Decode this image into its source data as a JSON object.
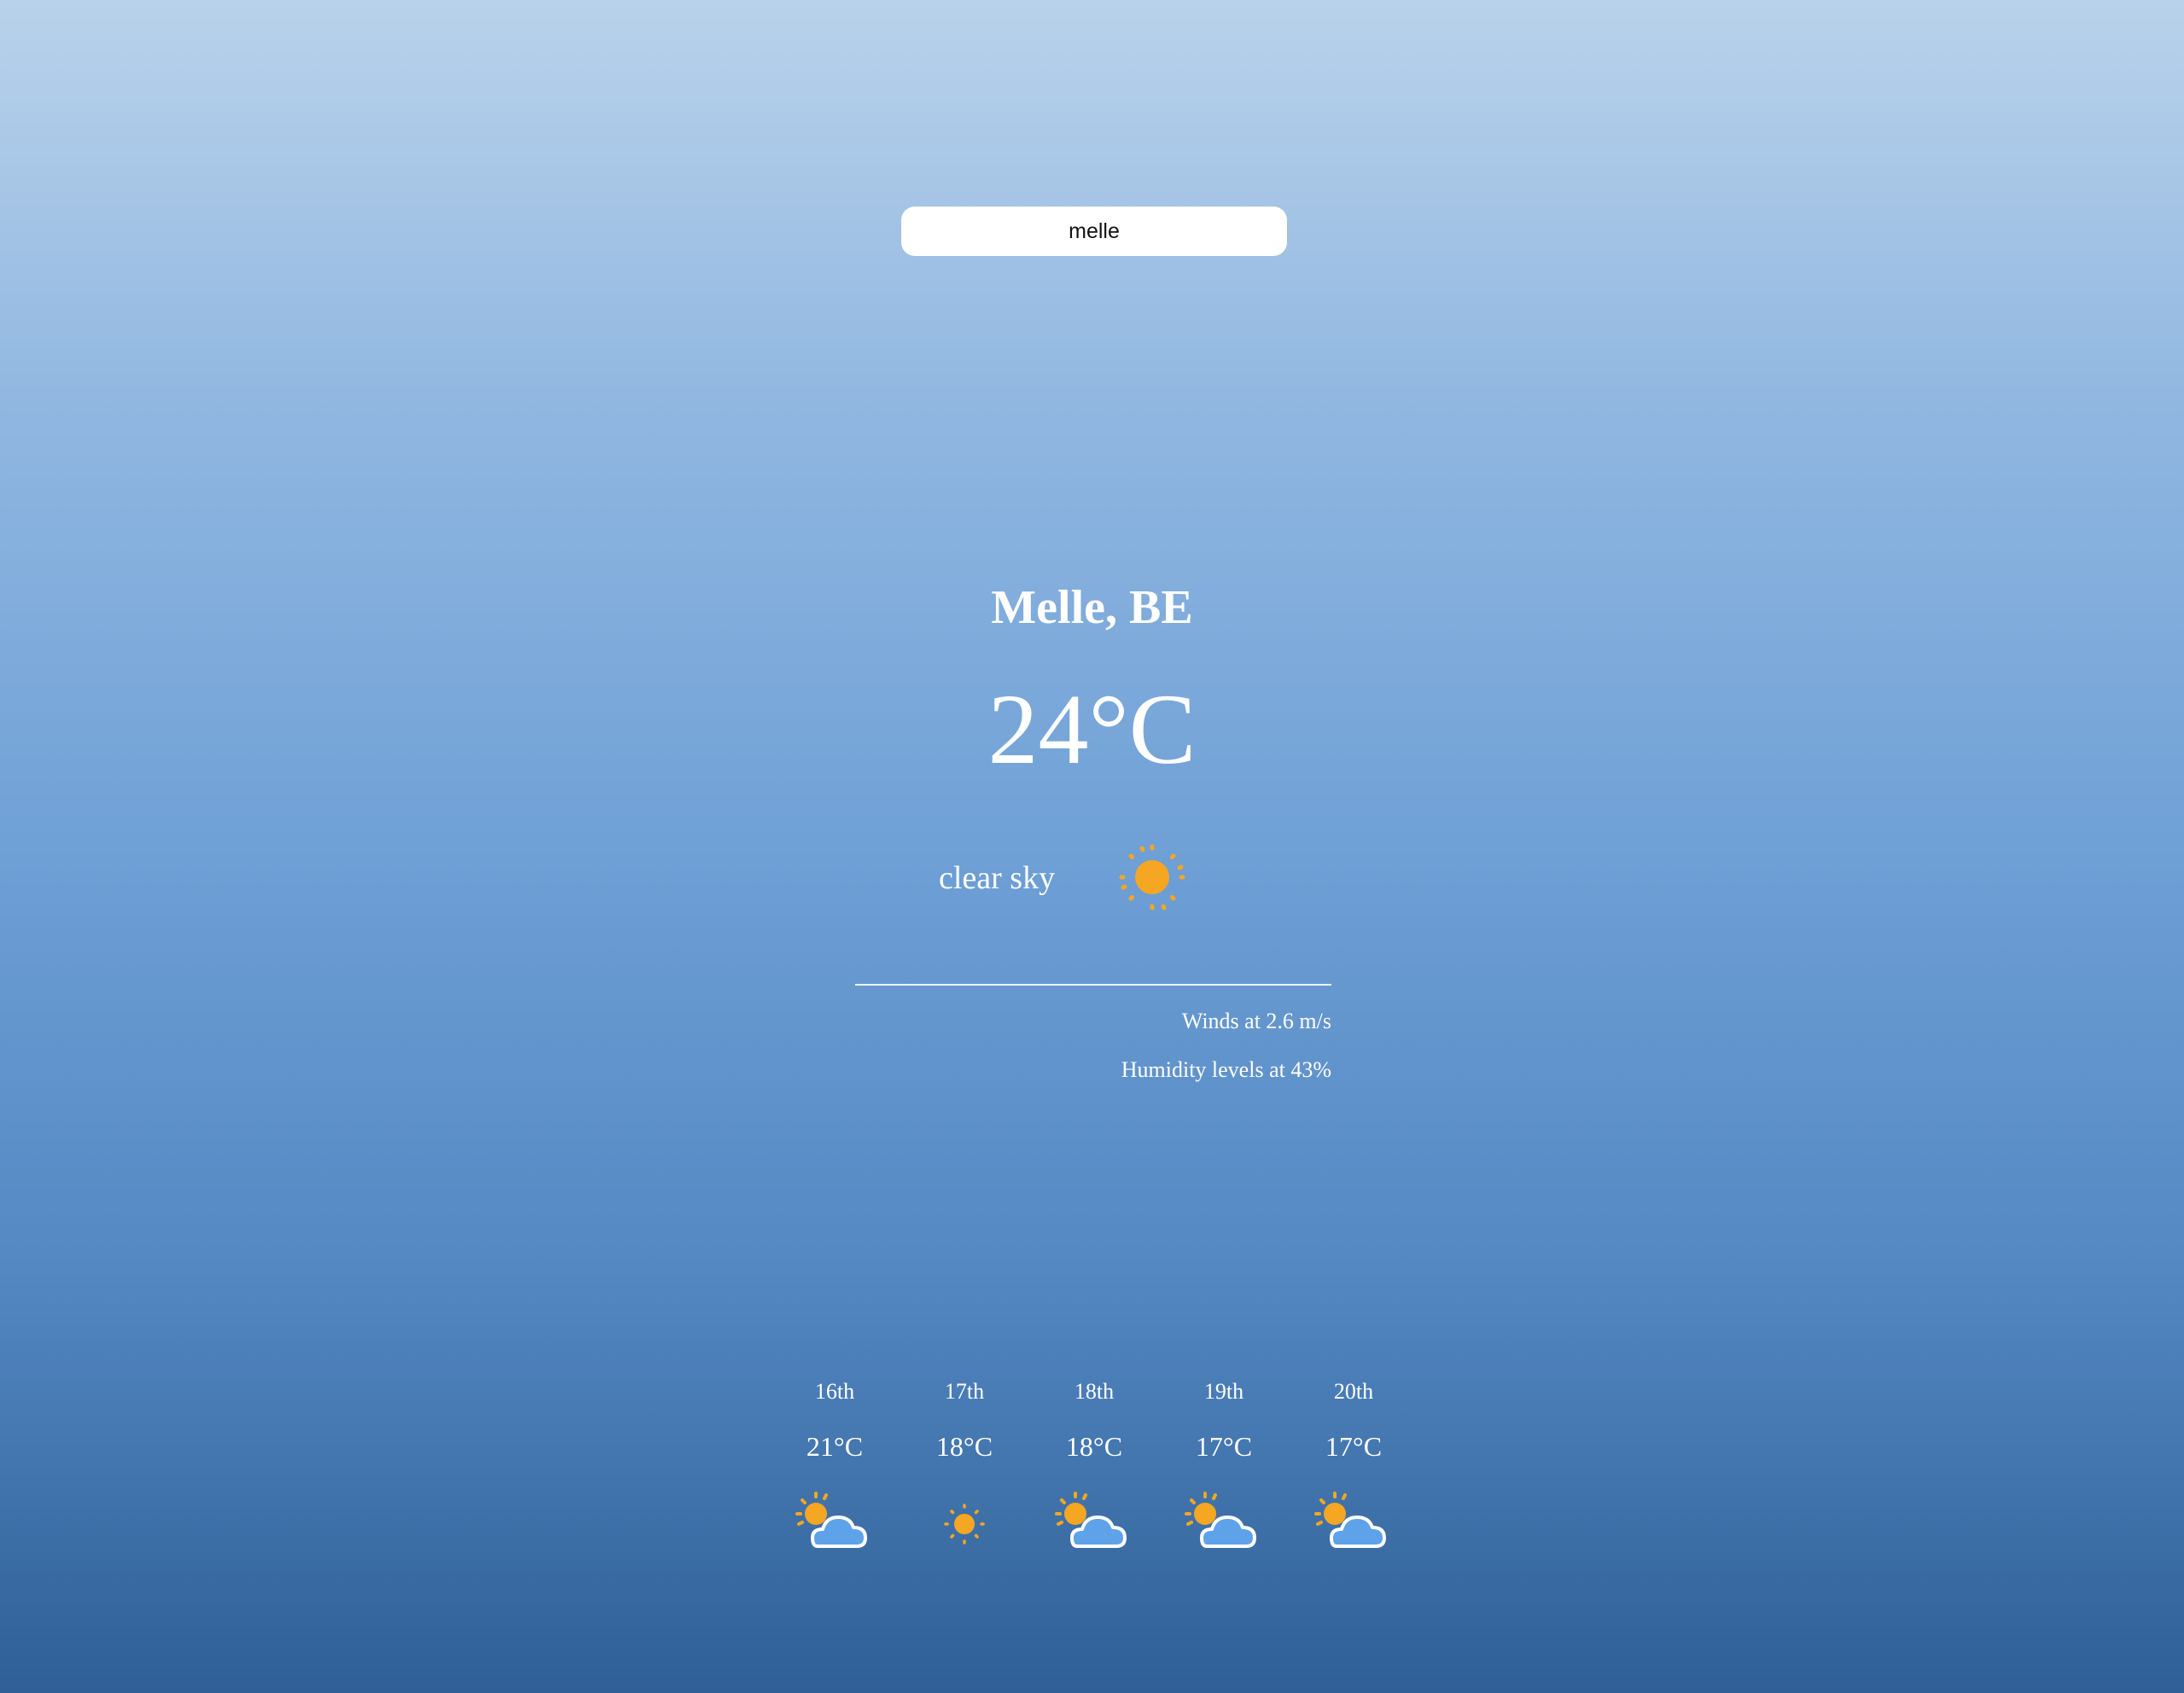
{
  "search": {
    "value": "melle",
    "placeholder": ""
  },
  "current": {
    "location": "Melle, BE",
    "temperature": "24°C",
    "condition": "clear sky",
    "condition_icon": "sun-icon",
    "wind": "Winds at 2.6 m/s",
    "humidity": "Humidity levels at 43%"
  },
  "forecast": [
    {
      "date": "16th",
      "temp": "21°C",
      "icon": "partly-cloudy-icon"
    },
    {
      "date": "17th",
      "temp": "18°C",
      "icon": "sun-icon"
    },
    {
      "date": "18th",
      "temp": "18°C",
      "icon": "partly-cloudy-icon"
    },
    {
      "date": "19th",
      "temp": "17°C",
      "icon": "partly-cloudy-icon"
    },
    {
      "date": "20th",
      "temp": "17°C",
      "icon": "partly-cloudy-icon"
    }
  ],
  "colors": {
    "sun": "#f5a623",
    "cloud": "#5ea2ea",
    "text": "#ffffff"
  }
}
